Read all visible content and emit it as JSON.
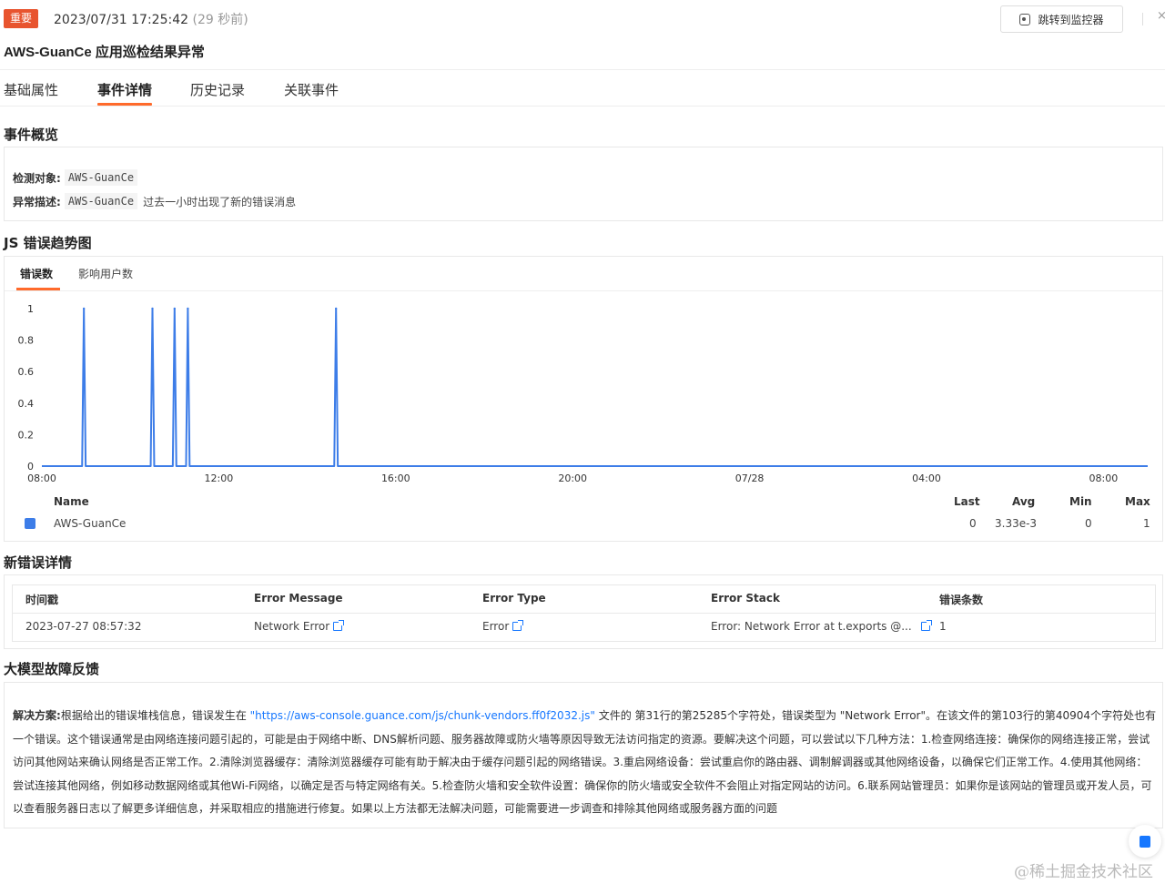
{
  "header": {
    "badge": "重要",
    "timestamp": "2023/07/31 17:25:42",
    "ago": "(29 秒前)",
    "jump_button": "跳转到监控器",
    "close_glyph": "×",
    "title": "AWS-GuanCe 应用巡检结果异常"
  },
  "tabs": [
    {
      "label": "基础属性"
    },
    {
      "label": "事件详情"
    },
    {
      "label": "历史记录"
    },
    {
      "label": "关联事件"
    }
  ],
  "active_tab": "事件详情",
  "overview": {
    "heading": "事件概览",
    "target_label": "检测对象:",
    "target_value": "AWS-GuanCe",
    "desc_label": "异常描述:",
    "desc_code": "AWS-GuanCe",
    "desc_text": "过去一小时出现了新的错误消息"
  },
  "trend": {
    "heading": "JS 错误趋势图",
    "tabs": [
      {
        "label": "错误数"
      },
      {
        "label": "影响用户数"
      }
    ],
    "legend": {
      "headers": {
        "name": "Name",
        "last": "Last",
        "avg": "Avg",
        "min": "Min",
        "max": "Max"
      },
      "rows": [
        {
          "name": "AWS-GuanCe",
          "last": "0",
          "avg": "3.33e-3",
          "min": "0",
          "max": "1"
        }
      ]
    }
  },
  "chart_data": {
    "type": "line",
    "title": "",
    "xlabel": "",
    "ylabel": "",
    "x_tick_labels": [
      "08:00",
      "12:00",
      "16:00",
      "20:00",
      "07/28",
      "04:00",
      "08:00"
    ],
    "y_tick_labels": [
      "0",
      "0.2",
      "0.4",
      "0.6",
      "0.8",
      "1"
    ],
    "ylim": [
      0,
      1
    ],
    "xlim_hours": [
      0,
      25
    ],
    "series": [
      {
        "name": "AWS-GuanCe",
        "color": "#3d7de8",
        "spikes_at_hour": [
          0.95,
          2.5,
          3.0,
          3.3,
          6.65
        ],
        "spike_value": 1,
        "baseline_value": 0
      }
    ],
    "grid": false,
    "legend_position": "bottom"
  },
  "errors": {
    "heading": "新错误详情",
    "columns": [
      "时间戳",
      "Error Message",
      "Error Type",
      "Error Stack",
      "错误条数"
    ],
    "rows": [
      {
        "time": "2023-07-27 08:57:32",
        "message": "Network Error",
        "type": "Error",
        "stack": "Error: Network Error at t.exports @...",
        "count": "1"
      }
    ]
  },
  "llm": {
    "heading": "大模型故障反馈",
    "label": "解决方案:",
    "text_before_url": "根据给出的错误堆栈信息，错误发生在 ",
    "url": "\"https://aws-console.guance.com/js/chunk-vendors.ff0f2032.js\"",
    "text_after_url": " 文件的 第31行的第25285个字符处，错误类型为 \"Network Error\"。在该文件的第103行的第40904个字符处也有一个错误。这个错误通常是由网络连接问题引起的，可能是由于网络中断、DNS解析问题、服务器故障或防火墙等原因导致无法访问指定的资源。要解决这个问题，可以尝试以下几种方法：1.检查网络连接：确保你的网络连接正常，尝试访问其他网站来确认网络是否正常工作。2.清除浏览器缓存：清除浏览器缓存可能有助于解决由于缓存问题引起的网络错误。3.重启网络设备：尝试重启你的路由器、调制解调器或其他网络设备，以确保它们正常工作。4.使用其他网络：尝试连接其他网络，例如移动数据网络或其他Wi-Fi网络，以确定是否与特定网络有关。5.检查防火墙和安全软件设置：确保你的防火墙或安全软件不会阻止对指定网站的访问。6.联系网站管理员：如果你是该网站的管理员或开发人员，可以查看服务器日志以了解更多详细信息，并采取相应的措施进行修复。如果以上方法都无法解决问题，可能需要进一步调查和排除其他网络或服务器方面的问题"
  },
  "watermark": "@稀土掘金技术社区"
}
